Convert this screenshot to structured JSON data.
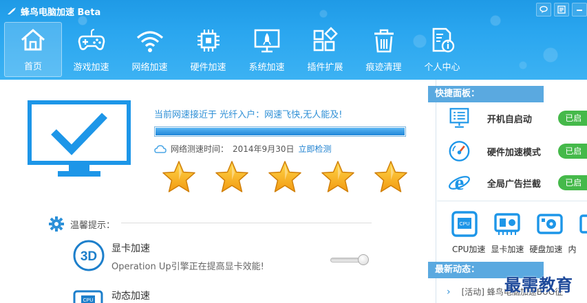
{
  "app": {
    "title": "蜂鸟电脑加速 Beta"
  },
  "window_buttons": [
    "feedback-icon",
    "menu-icon",
    "minimize-icon"
  ],
  "nav": [
    {
      "label": "首页",
      "icon": "home-icon",
      "active": true
    },
    {
      "label": "游戏加速",
      "icon": "gamepad-icon"
    },
    {
      "label": "网络加速",
      "icon": "wifi-icon"
    },
    {
      "label": "硬件加速",
      "icon": "chip-icon"
    },
    {
      "label": "系统加速",
      "icon": "rocket-monitor-icon"
    },
    {
      "label": "插件扩展",
      "icon": "plugin-icon"
    },
    {
      "label": "痕迹清理",
      "icon": "trash-icon"
    },
    {
      "label": "个人中心",
      "icon": "profile-icon"
    }
  ],
  "main": {
    "status_text": "当前网速接近于 光纤入户：网速飞快,无人能及!",
    "progress": 1.0,
    "test_time_label": "网络测速时间：",
    "test_time_value": "2014年9月30日",
    "test_now_link": "立即检测",
    "rating": 5,
    "tips_label": "温馨提示：",
    "tips": [
      {
        "title": "显卡加速",
        "desc": "Operation Up引擎正在提高显卡效能!",
        "icon": "3d-icon"
      },
      {
        "title": "动态加速",
        "desc": "",
        "icon": "cpu-icon"
      }
    ]
  },
  "side": {
    "quick_title": "快捷面板：",
    "quick_items": [
      {
        "label": "开机自启动",
        "badge": "已启",
        "icon": "startup-icon"
      },
      {
        "label": "硬件加速模式",
        "badge": "已启",
        "icon": "gauge-icon"
      },
      {
        "label": "全局广告拦截",
        "badge": "已启",
        "icon": "ie-icon"
      }
    ],
    "tools": [
      {
        "label": "CPU加速",
        "icon": "cpu-chip-icon"
      },
      {
        "label": "显卡加速",
        "icon": "gpu-icon"
      },
      {
        "label": "硬盘加速",
        "icon": "disk-icon"
      },
      {
        "label": "内",
        "icon": "memory-icon"
      }
    ],
    "news_title": "最新动态：",
    "news_item": "[活动] 蜂鸟电脑加速BUG征"
  },
  "watermark": "最需教育",
  "colors": {
    "brand_blue": "#2aa6ef",
    "accent_green": "#45b94a",
    "side_title": "#5aa9e0",
    "monitor_blue": "#1d96e8"
  }
}
